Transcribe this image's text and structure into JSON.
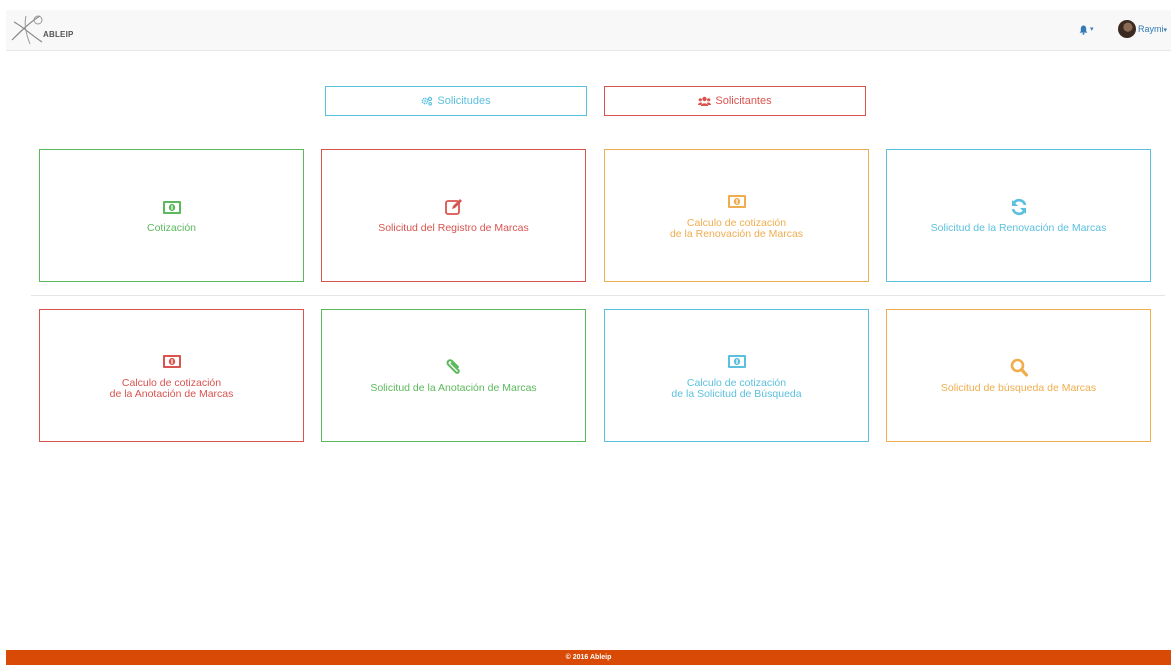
{
  "brand": {
    "name": "ABLEIP"
  },
  "header": {
    "username": "Raymi",
    "caret": "▾"
  },
  "tabs": [
    {
      "label": "Solicitudes",
      "icon": "gears-icon",
      "color": "#5bc0de"
    },
    {
      "label": "Solicitantes",
      "icon": "users-icon",
      "color": "#d9534f"
    }
  ],
  "cards": [
    {
      "label": "Cotización",
      "icon": "money-icon",
      "color": "#5cb85c"
    },
    {
      "label": "Solicitud del Registro de Marcas",
      "icon": "edit-icon",
      "color": "#d9534f"
    },
    {
      "label": "Calculo de cotización\nde la Renovación de Marcas",
      "icon": "money-icon",
      "color": "#f0ad4e"
    },
    {
      "label": "Solicitud de la Renovación de Marcas",
      "icon": "refresh-icon",
      "color": "#5bc0de"
    },
    {
      "label": "Calculo de cotización\nde la Anotación de Marcas",
      "icon": "money-icon",
      "color": "#d9534f"
    },
    {
      "label": "Solicitud de la Anotación de Marcas",
      "icon": "paperclip-icon",
      "color": "#5cb85c"
    },
    {
      "label": "Calculo de cotización\nde la Solicitud de Búsqueda",
      "icon": "money-icon",
      "color": "#5bc0de"
    },
    {
      "label": "Solicitud de búsqueda de Marcas",
      "icon": "search-icon",
      "color": "#f0ad4e"
    }
  ],
  "footer": {
    "text": "© 2016 Ableip"
  }
}
